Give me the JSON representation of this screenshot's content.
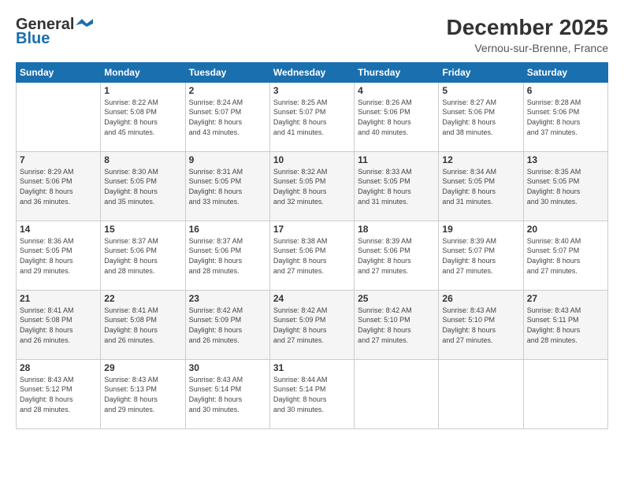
{
  "header": {
    "logo": {
      "line1": "General",
      "line2": "Blue"
    },
    "title": "December 2025",
    "location": "Vernou-sur-Brenne, France"
  },
  "days_of_week": [
    "Sunday",
    "Monday",
    "Tuesday",
    "Wednesday",
    "Thursday",
    "Friday",
    "Saturday"
  ],
  "weeks": [
    [
      {
        "day": "",
        "data": ""
      },
      {
        "day": "1",
        "data": "Sunrise: 8:22 AM\nSunset: 5:08 PM\nDaylight: 8 hours\nand 45 minutes."
      },
      {
        "day": "2",
        "data": "Sunrise: 8:24 AM\nSunset: 5:07 PM\nDaylight: 8 hours\nand 43 minutes."
      },
      {
        "day": "3",
        "data": "Sunrise: 8:25 AM\nSunset: 5:07 PM\nDaylight: 8 hours\nand 41 minutes."
      },
      {
        "day": "4",
        "data": "Sunrise: 8:26 AM\nSunset: 5:06 PM\nDaylight: 8 hours\nand 40 minutes."
      },
      {
        "day": "5",
        "data": "Sunrise: 8:27 AM\nSunset: 5:06 PM\nDaylight: 8 hours\nand 38 minutes."
      },
      {
        "day": "6",
        "data": "Sunrise: 8:28 AM\nSunset: 5:06 PM\nDaylight: 8 hours\nand 37 minutes."
      }
    ],
    [
      {
        "day": "7",
        "data": "Sunrise: 8:29 AM\nSunset: 5:06 PM\nDaylight: 8 hours\nand 36 minutes."
      },
      {
        "day": "8",
        "data": "Sunrise: 8:30 AM\nSunset: 5:05 PM\nDaylight: 8 hours\nand 35 minutes."
      },
      {
        "day": "9",
        "data": "Sunrise: 8:31 AM\nSunset: 5:05 PM\nDaylight: 8 hours\nand 33 minutes."
      },
      {
        "day": "10",
        "data": "Sunrise: 8:32 AM\nSunset: 5:05 PM\nDaylight: 8 hours\nand 32 minutes."
      },
      {
        "day": "11",
        "data": "Sunrise: 8:33 AM\nSunset: 5:05 PM\nDaylight: 8 hours\nand 31 minutes."
      },
      {
        "day": "12",
        "data": "Sunrise: 8:34 AM\nSunset: 5:05 PM\nDaylight: 8 hours\nand 31 minutes."
      },
      {
        "day": "13",
        "data": "Sunrise: 8:35 AM\nSunset: 5:05 PM\nDaylight: 8 hours\nand 30 minutes."
      }
    ],
    [
      {
        "day": "14",
        "data": "Sunrise: 8:36 AM\nSunset: 5:05 PM\nDaylight: 8 hours\nand 29 minutes."
      },
      {
        "day": "15",
        "data": "Sunrise: 8:37 AM\nSunset: 5:06 PM\nDaylight: 8 hours\nand 28 minutes."
      },
      {
        "day": "16",
        "data": "Sunrise: 8:37 AM\nSunset: 5:06 PM\nDaylight: 8 hours\nand 28 minutes."
      },
      {
        "day": "17",
        "data": "Sunrise: 8:38 AM\nSunset: 5:06 PM\nDaylight: 8 hours\nand 27 minutes."
      },
      {
        "day": "18",
        "data": "Sunrise: 8:39 AM\nSunset: 5:06 PM\nDaylight: 8 hours\nand 27 minutes."
      },
      {
        "day": "19",
        "data": "Sunrise: 8:39 AM\nSunset: 5:07 PM\nDaylight: 8 hours\nand 27 minutes."
      },
      {
        "day": "20",
        "data": "Sunrise: 8:40 AM\nSunset: 5:07 PM\nDaylight: 8 hours\nand 27 minutes."
      }
    ],
    [
      {
        "day": "21",
        "data": "Sunrise: 8:41 AM\nSunset: 5:08 PM\nDaylight: 8 hours\nand 26 minutes."
      },
      {
        "day": "22",
        "data": "Sunrise: 8:41 AM\nSunset: 5:08 PM\nDaylight: 8 hours\nand 26 minutes."
      },
      {
        "day": "23",
        "data": "Sunrise: 8:42 AM\nSunset: 5:09 PM\nDaylight: 8 hours\nand 26 minutes."
      },
      {
        "day": "24",
        "data": "Sunrise: 8:42 AM\nSunset: 5:09 PM\nDaylight: 8 hours\nand 27 minutes."
      },
      {
        "day": "25",
        "data": "Sunrise: 8:42 AM\nSunset: 5:10 PM\nDaylight: 8 hours\nand 27 minutes."
      },
      {
        "day": "26",
        "data": "Sunrise: 8:43 AM\nSunset: 5:10 PM\nDaylight: 8 hours\nand 27 minutes."
      },
      {
        "day": "27",
        "data": "Sunrise: 8:43 AM\nSunset: 5:11 PM\nDaylight: 8 hours\nand 28 minutes."
      }
    ],
    [
      {
        "day": "28",
        "data": "Sunrise: 8:43 AM\nSunset: 5:12 PM\nDaylight: 8 hours\nand 28 minutes."
      },
      {
        "day": "29",
        "data": "Sunrise: 8:43 AM\nSunset: 5:13 PM\nDaylight: 8 hours\nand 29 minutes."
      },
      {
        "day": "30",
        "data": "Sunrise: 8:43 AM\nSunset: 5:14 PM\nDaylight: 8 hours\nand 30 minutes."
      },
      {
        "day": "31",
        "data": "Sunrise: 8:44 AM\nSunset: 5:14 PM\nDaylight: 8 hours\nand 30 minutes."
      },
      {
        "day": "",
        "data": ""
      },
      {
        "day": "",
        "data": ""
      },
      {
        "day": "",
        "data": ""
      }
    ]
  ]
}
